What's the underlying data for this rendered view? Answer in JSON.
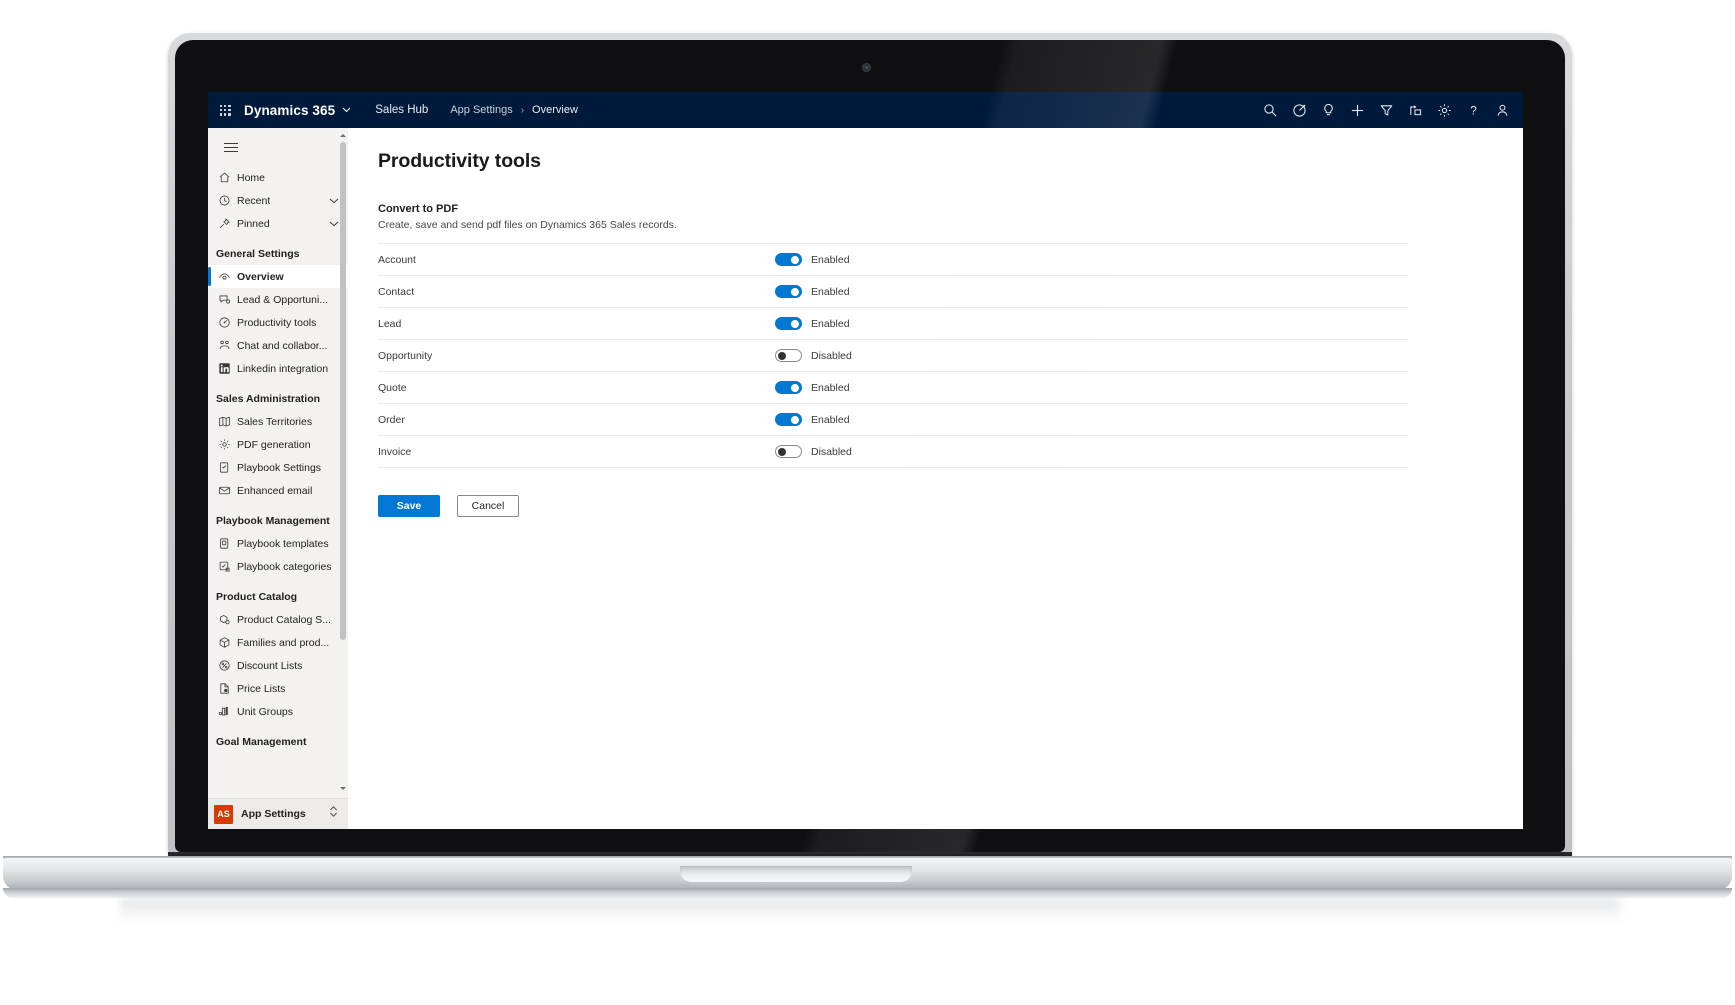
{
  "header": {
    "waffle_icon": "app-launcher-waffle-icon",
    "brand": "Dynamics 365",
    "brand_chevron": "⌄",
    "app_name": "Sales Hub",
    "breadcrumb": [
      {
        "label": "App Settings",
        "icon": ""
      },
      {
        "label": "Overview",
        "icon": ""
      }
    ],
    "breadcrumb_separator": "›",
    "icons": [
      {
        "name": "search-icon",
        "title": "Search"
      },
      {
        "name": "assistant-icon",
        "title": "Assistant"
      },
      {
        "name": "lightbulb-icon",
        "title": "Insights"
      },
      {
        "name": "plus-icon",
        "title": "Quick create"
      },
      {
        "name": "filter-icon",
        "title": "Filter"
      },
      {
        "name": "flow-icon",
        "title": "Flow"
      },
      {
        "name": "gear-icon",
        "title": "Settings"
      },
      {
        "name": "help-icon",
        "title": "Help"
      },
      {
        "name": "user-avatar-icon",
        "title": "Account manager"
      }
    ]
  },
  "sidebar": {
    "hamburger_icon": "hamburger-menu-icon",
    "top_items": [
      {
        "label": "Home",
        "icon": "home-icon",
        "expandable": false
      },
      {
        "label": "Recent",
        "icon": "clock-icon",
        "expandable": true
      },
      {
        "label": "Pinned",
        "icon": "pin-icon",
        "expandable": true
      }
    ],
    "groups": [
      {
        "title": "General Settings",
        "items": [
          {
            "label": "Overview",
            "icon": "overview-icon",
            "active": true
          },
          {
            "label": "Lead & Opportuni...",
            "icon": "lead-opportunity-icon",
            "active": false
          },
          {
            "label": "Productivity tools",
            "icon": "productivity-icon",
            "active": false
          },
          {
            "label": "Chat and collabor...",
            "icon": "chat-collaboration-icon",
            "active": false
          },
          {
            "label": "Linkedin integration",
            "icon": "linkedin-icon",
            "active": false
          }
        ]
      },
      {
        "title": "Sales Administration",
        "items": [
          {
            "label": "Sales Territories",
            "icon": "map-icon",
            "active": false
          },
          {
            "label": "PDF generation",
            "icon": "gear-icon",
            "active": false
          },
          {
            "label": "Playbook Settings",
            "icon": "playbook-settings-icon",
            "active": false
          },
          {
            "label": "Enhanced email",
            "icon": "envelope-icon",
            "active": false
          }
        ]
      },
      {
        "title": "Playbook Management",
        "items": [
          {
            "label": "Playbook templates",
            "icon": "playbook-template-icon",
            "active": false
          },
          {
            "label": "Playbook categories",
            "icon": "playbook-category-icon",
            "active": false
          }
        ]
      },
      {
        "title": "Product Catalog",
        "items": [
          {
            "label": "Product Catalog S...",
            "icon": "product-catalog-icon",
            "active": false
          },
          {
            "label": "Families and prod...",
            "icon": "box-icon",
            "active": false
          },
          {
            "label": "Discount Lists",
            "icon": "percent-icon",
            "active": false
          },
          {
            "label": "Price Lists",
            "icon": "price-list-icon",
            "active": false
          },
          {
            "label": "Unit Groups",
            "icon": "unit-groups-icon",
            "active": false
          }
        ]
      },
      {
        "title": "Goal Management",
        "items": []
      }
    ],
    "app_switcher": {
      "badge": "AS",
      "label": "App Settings",
      "chevron_icon": "up-down-chevron-icon"
    },
    "scrollbar": {
      "up_arrow_icon": "scroll-up-arrow-icon",
      "down_arrow_icon": "scroll-down-arrow-icon"
    }
  },
  "main": {
    "page_title": "Productivity tools",
    "section": {
      "title": "Convert to PDF",
      "description": "Create, save and send pdf files on Dynamics 365 Sales records."
    },
    "settings": [
      {
        "label": "Account",
        "enabled": true,
        "state": "Enabled"
      },
      {
        "label": "Contact",
        "enabled": true,
        "state": "Enabled"
      },
      {
        "label": "Lead",
        "enabled": true,
        "state": "Enabled"
      },
      {
        "label": "Opportunity",
        "enabled": false,
        "state": "Disabled"
      },
      {
        "label": "Quote",
        "enabled": true,
        "state": "Enabled"
      },
      {
        "label": "Order",
        "enabled": true,
        "state": "Enabled"
      },
      {
        "label": "Invoice",
        "enabled": false,
        "state": "Disabled"
      }
    ],
    "buttons": {
      "save": "Save",
      "cancel": "Cancel"
    }
  },
  "colors": {
    "header_bg": "#001a3c",
    "accent": "#0078d4",
    "sidebar_bg": "#f3f2f1",
    "app_badge": "#d83b01",
    "toggle_off_border": "#8a8886"
  }
}
